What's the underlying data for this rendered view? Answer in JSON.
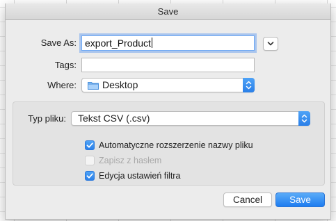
{
  "dialog": {
    "title": "Save",
    "save_as_label": "Save As:",
    "save_as_value": "export_Product",
    "tags_label": "Tags:",
    "tags_value": "",
    "where_label": "Where:",
    "where_value": "Desktop"
  },
  "options": {
    "file_type_label": "Typ pliku:",
    "file_type_value": "Tekst CSV (.csv)",
    "checkboxes": [
      {
        "label": "Automatyczne rozszerzenie nazwy pliku",
        "checked": true,
        "enabled": true
      },
      {
        "label": "Zapisz z hasłem",
        "checked": false,
        "enabled": false
      },
      {
        "label": "Edycja ustawień filtra",
        "checked": true,
        "enabled": true
      }
    ]
  },
  "buttons": {
    "cancel_label": "Cancel",
    "save_label": "Save"
  },
  "icons": {
    "expand": "chevron-down-icon",
    "folder": "folder-icon",
    "stepper": "up-down-stepper-icon",
    "check": "checkmark-icon"
  },
  "colors": {
    "accent": "#2a7fe8",
    "focus_ring": "#6fa9f4",
    "dialog_bg": "#ececec"
  }
}
